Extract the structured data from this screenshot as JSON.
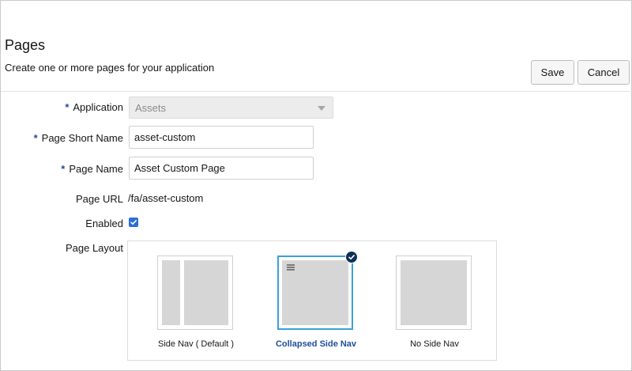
{
  "header": {
    "title": "Pages",
    "subtitle": "Create one or more pages for your application"
  },
  "toolbar": {
    "save_label": "Save",
    "cancel_label": "Cancel"
  },
  "form": {
    "application": {
      "label": "Application",
      "value": "Assets",
      "required": true,
      "disabled": true
    },
    "page_short_name": {
      "label": "Page Short Name",
      "value": "asset-custom",
      "required": true
    },
    "page_name": {
      "label": "Page Name",
      "value": "Asset Custom Page",
      "required": true
    },
    "page_url": {
      "label": "Page URL",
      "value": "/fa/asset-custom"
    },
    "enabled": {
      "label": "Enabled",
      "checked": true
    },
    "page_layout": {
      "label": "Page Layout",
      "options": [
        {
          "label": "Side Nav ( Default )",
          "selected": false
        },
        {
          "label": "Collapsed Side Nav",
          "selected": true
        },
        {
          "label": "No Side Nav",
          "selected": false
        }
      ]
    }
  },
  "required_marker": "*",
  "colors": {
    "required_marker": "#1f4e9c",
    "selected_border": "#3aa1d6",
    "selected_label": "#1f4e9c",
    "checkbox": "#2b6fd6",
    "check_badge": "#0f3056"
  },
  "icons": {
    "dropdown": "chevron-down-icon",
    "enabled_check": "checkmark-icon",
    "selected_badge": "check-circle-icon",
    "collapsed_menu": "hamburger-icon"
  }
}
